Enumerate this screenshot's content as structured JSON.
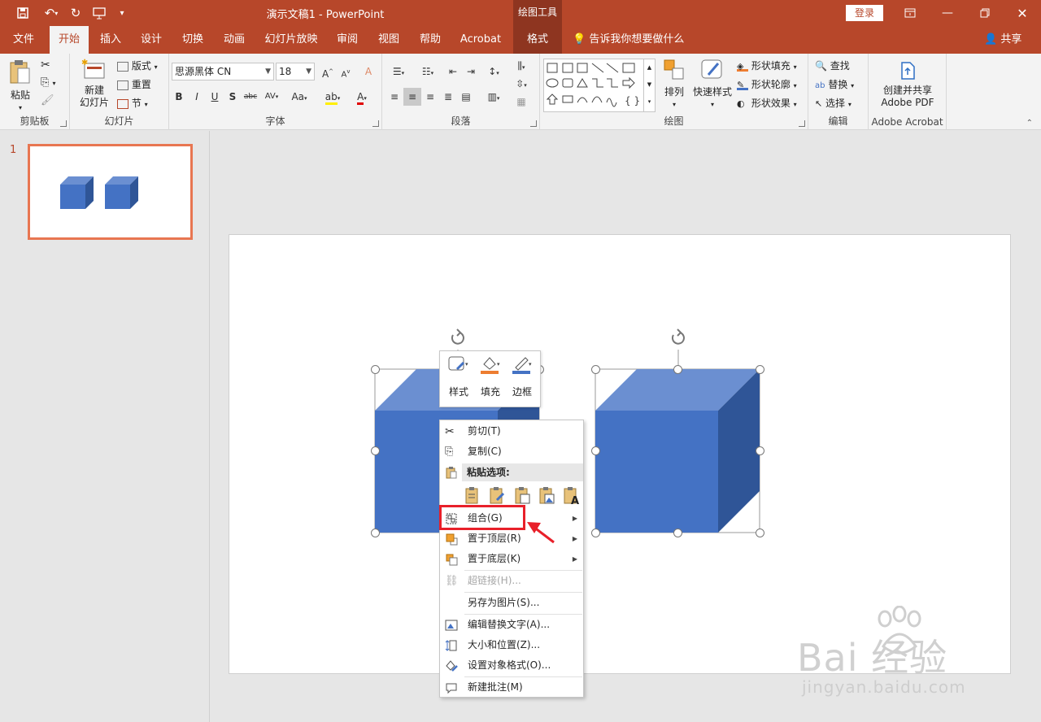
{
  "titlebar": {
    "doc_title": "演示文稿1  -  PowerPoint",
    "contextual_header": "绘图工具",
    "login": "登录"
  },
  "tabs": {
    "file": "文件",
    "home": "开始",
    "insert": "插入",
    "design": "设计",
    "transitions": "切换",
    "animations": "动画",
    "slideshow": "幻灯片放映",
    "review": "审阅",
    "view": "视图",
    "help": "帮助",
    "acrobat": "Acrobat",
    "format": "格式",
    "tell_me": "告诉我你想要做什么",
    "share": "共享"
  },
  "ribbon": {
    "clipboard": {
      "label": "剪贴板",
      "paste": "粘贴"
    },
    "slides": {
      "label": "幻灯片",
      "new_slide_1": "新建",
      "new_slide_2": "幻灯片",
      "layout": "版式",
      "reset": "重置",
      "section": "节"
    },
    "font": {
      "label": "字体",
      "font_name": "思源黑体 CN",
      "font_size": "18"
    },
    "paragraph": {
      "label": "段落"
    },
    "drawing": {
      "label": "绘图",
      "arrange": "排列",
      "quick_styles": "快速样式",
      "shape_fill": "形状填充",
      "shape_outline": "形状轮廓",
      "shape_effects": "形状效果"
    },
    "editing": {
      "label": "编辑",
      "find": "查找",
      "replace": "替换",
      "select": "选择"
    },
    "acrobat": {
      "label": "Adobe Acrobat",
      "create_line1": "创建并共享",
      "create_line2": "Adobe PDF"
    }
  },
  "thumbnails": {
    "slide_number": "1"
  },
  "mini_toolbar": {
    "style": "样式",
    "fill": "填充",
    "border": "边框"
  },
  "context_menu": {
    "cut": "剪切(T)",
    "copy": "复制(C)",
    "paste_options": "粘贴选项:",
    "group": "组合(G)",
    "bring_to_front": "置于顶层(R)",
    "send_to_back": "置于底层(K)",
    "hyperlink": "超链接(H)...",
    "save_as_picture": "另存为图片(S)...",
    "edit_alt_text": "编辑替换文字(A)...",
    "size_position": "大小和位置(Z)...",
    "format_object": "设置对象格式(O)...",
    "new_comment": "新建批注(M)"
  },
  "watermark": {
    "text": "Bai  经验",
    "url": "jingyan.baidu.com"
  },
  "colors": {
    "brand": "#b7472a",
    "cube_front": "#4472c4",
    "cube_top": "#6b8fd1",
    "cube_side": "#2f5597",
    "highlight": "#e8202a"
  }
}
